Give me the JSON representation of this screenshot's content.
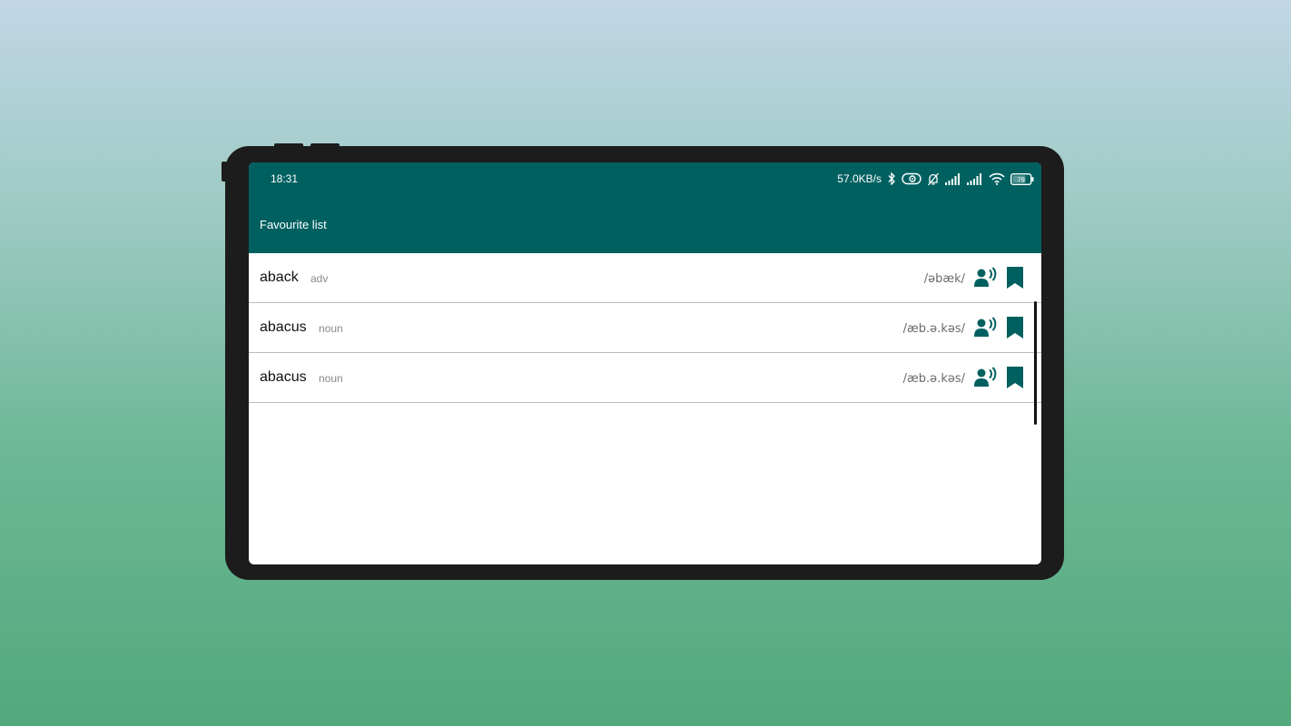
{
  "status_bar": {
    "time": "18:31",
    "network_speed": "57.0KB/s",
    "battery_level": "79",
    "icons": [
      "bluetooth-icon",
      "hotspot-icon",
      "mute-bell-icon",
      "signal-icon",
      "signal-icon",
      "wifi-icon",
      "battery-icon"
    ]
  },
  "appbar": {
    "title": "Favourite list"
  },
  "favourites": [
    {
      "word": "aback",
      "pos": "adv",
      "phonetic": "/əbæk/"
    },
    {
      "word": "abacus",
      "pos": "noun",
      "phonetic": "/æb.ə.kəs/"
    },
    {
      "word": "abacus",
      "pos": "noun",
      "phonetic": "/æb.ə.kəs/"
    }
  ],
  "colors": {
    "primary": "#006060",
    "divider": "#bdbdbd"
  }
}
